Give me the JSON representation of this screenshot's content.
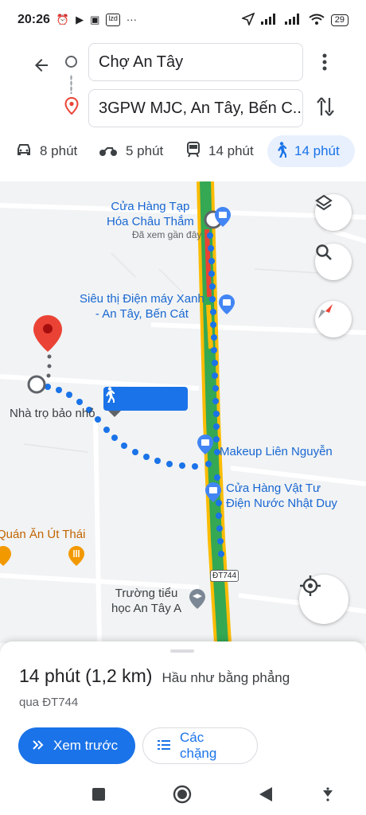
{
  "status_bar": {
    "time": "20:26",
    "left_icons": [
      "alarm-icon",
      "play-icon",
      "image-icon",
      "app-badge-icon",
      "more-dots-icon"
    ],
    "lzd": "lzd",
    "battery": "29"
  },
  "directions": {
    "origin": "Chợ An Tây",
    "destination": "3GPW MJC, An Tây, Bến C...",
    "modes": [
      {
        "icon": "car-icon",
        "label": "8 phút",
        "active": false
      },
      {
        "icon": "motorbike-icon",
        "label": "5 phút",
        "active": false
      },
      {
        "icon": "transit-icon",
        "label": "14 phút",
        "active": false
      },
      {
        "icon": "walk-icon",
        "label": "14 phút",
        "active": true
      }
    ]
  },
  "map": {
    "pois": {
      "shop1": "Cửa Hàng Tạp\nHóa Châu Thắm",
      "shop1_note": "Đã xem gần đây",
      "dmx": "Siêu thị Điện máy Xanh\n- An Tây, Bến Cát",
      "motel": "Nhà trọ bảo nhỏ",
      "makeup": "Makeup Liên Nguyễn",
      "hardware": "Cửa Hàng Vật Tư\nĐiện Nước Nhật Duy",
      "restaurant": "Quán Ăn Út Thái",
      "school": "Trường tiểu\nhọc An Tây A"
    },
    "road_label": "ĐT744",
    "route_badge_icon": "walk-icon"
  },
  "route_sheet": {
    "duration": "14 phút (1,2 km)",
    "terrain": "Hầu như bằng phẳng",
    "via": "qua ĐT744",
    "preview_button": "Xem trước",
    "steps_button": "Các chặng"
  },
  "colors": {
    "accent": "#1a73e8",
    "route_green": "#34a853",
    "road_yellow": "#fbbc04",
    "pin_red": "#ea4335"
  }
}
